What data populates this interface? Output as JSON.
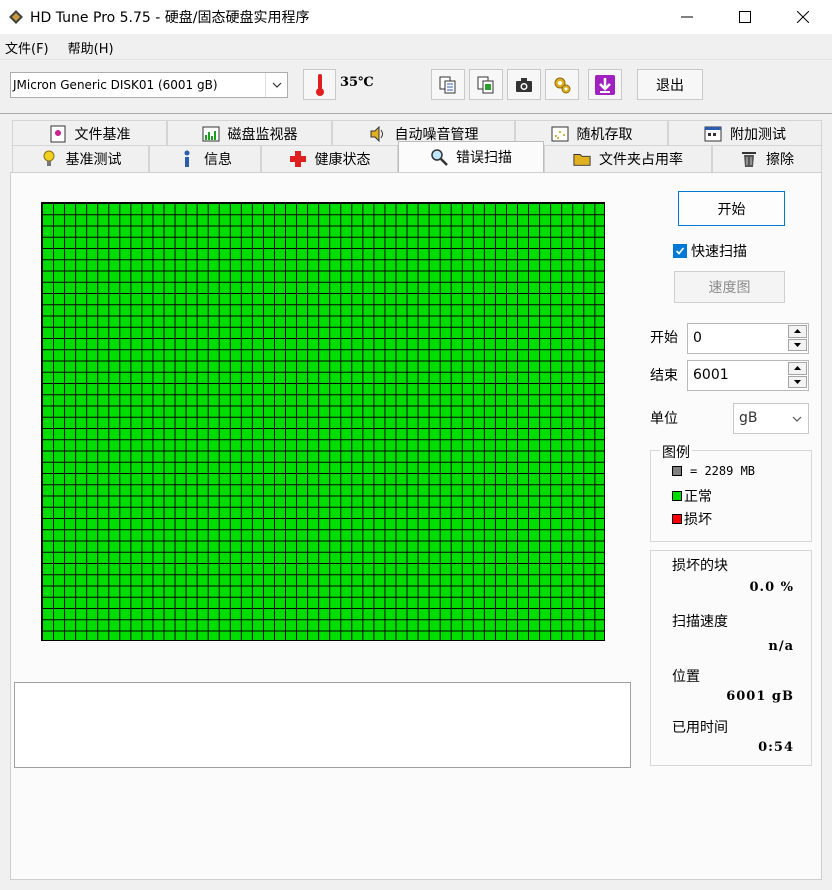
{
  "window": {
    "title": "HD Tune Pro 5.75 - 硬盘/固态硬盘实用程序",
    "minimize_icon": "minimize-icon",
    "maximize_icon": "maximize-icon",
    "close_icon": "close-icon"
  },
  "menubar": {
    "items": [
      "文件(F)",
      "帮助(H)"
    ]
  },
  "toolbar": {
    "drive": "JMicron Generic DISK01 (6001 gB)",
    "temperature": "35℃",
    "exit_label": "退出",
    "icons": [
      "thermometer-icon",
      "copy-icon",
      "copy-all-icon",
      "camera-icon",
      "settings-icon",
      "save-down-icon"
    ]
  },
  "tabs": {
    "row1": [
      {
        "label": "文件基准",
        "icon": "file-benchmark-icon"
      },
      {
        "label": "磁盘监视器",
        "icon": "disk-monitor-icon"
      },
      {
        "label": "自动噪音管理",
        "icon": "speaker-icon"
      },
      {
        "label": "随机存取",
        "icon": "random-access-icon"
      },
      {
        "label": "附加测试",
        "icon": "extra-tests-icon"
      }
    ],
    "row2": [
      {
        "label": "基准测试",
        "icon": "benchmark-icon"
      },
      {
        "label": "信息",
        "icon": "info-icon"
      },
      {
        "label": "健康状态",
        "icon": "health-icon"
      },
      {
        "label": "错误扫描",
        "icon": "error-scan-icon",
        "active": true
      },
      {
        "label": "文件夹占用率",
        "icon": "folder-icon"
      },
      {
        "label": "擦除",
        "icon": "erase-icon"
      }
    ]
  },
  "scan": {
    "start_button": "开始",
    "quick_scan_label": "快速扫描",
    "quick_scan_checked": true,
    "speed_map_button": "速度图",
    "start_label": "开始",
    "start_value": "0",
    "end_label": "结束",
    "end_value": "6001",
    "unit_label": "单位",
    "unit_value": "gB",
    "grid_color": "#00dd00",
    "blocks_ok_fraction": 1.0
  },
  "legend": {
    "title": "图例",
    "block_size": "= 2289 MB",
    "ok_label": "正常",
    "bad_label": "损坏",
    "ok_color": "#00dd00",
    "bad_color": "#ff0000",
    "block_color": "#808080"
  },
  "stats": {
    "bad_blocks_label": "损坏的块",
    "bad_blocks_value": "0.0 %",
    "scan_speed_label": "扫描速度",
    "scan_speed_value": "n/a",
    "position_label": "位置",
    "position_value": "6001 gB",
    "elapsed_label": "已用时间",
    "elapsed_value": "0:54"
  }
}
